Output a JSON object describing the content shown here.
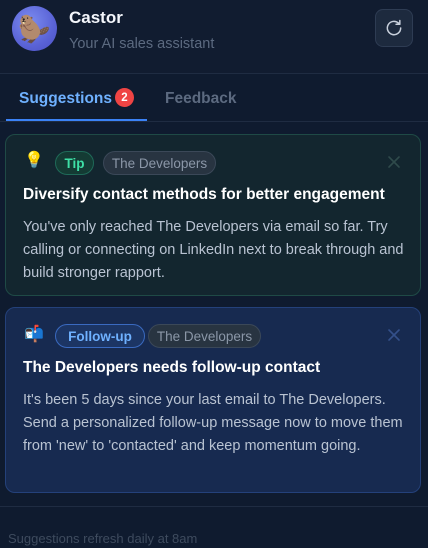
{
  "header": {
    "title": "Castor",
    "subtitle": "Your AI sales assistant",
    "avatar_icon": "beaver-icon",
    "refresh_icon": "refresh-icon"
  },
  "tabs": [
    {
      "label": "Suggestions",
      "badge": "2",
      "active": true
    },
    {
      "label": "Feedback",
      "active": false
    }
  ],
  "cards": [
    {
      "icon": "lightbulb-icon",
      "type_label": "Tip",
      "company": "The Developers",
      "title": "Diversify contact methods for better engagement",
      "body": "You've only reached The Developers via email so far. Try calling or connecting on LinkedIn next to break through and build stronger rapport."
    },
    {
      "icon": "mailbox-icon",
      "type_label": "Follow-up",
      "company": "The Developers",
      "title": "The Developers needs follow-up contact",
      "body": "It's been 5 days since your last email to The Developers. Send a personalized follow-up message now to move them from 'new' to 'contacted' and keep momentum going."
    }
  ],
  "footer": {
    "text": "Suggestions refresh daily at 8am"
  },
  "colors": {
    "background": "#0f1b2f",
    "accent": "#3b82f6",
    "tip_green": "#3ee0a6",
    "badge_red": "#ef4444"
  }
}
